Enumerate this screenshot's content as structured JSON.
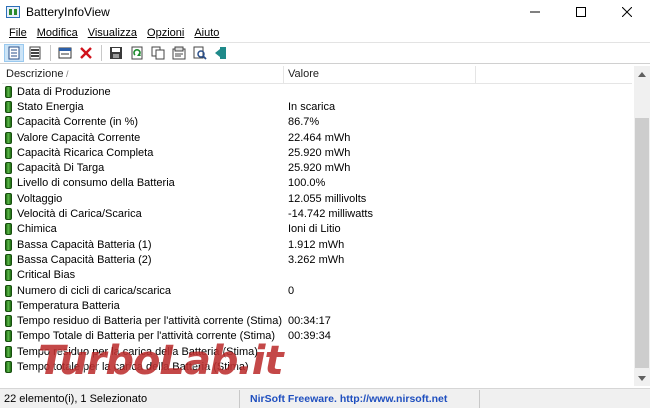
{
  "window": {
    "title": "BatteryInfoView"
  },
  "menu": [
    {
      "label": "File",
      "name": "menu-file"
    },
    {
      "label": "Modifica",
      "name": "menu-modifica"
    },
    {
      "label": "Visualizza",
      "name": "menu-visualizza"
    },
    {
      "label": "Opzioni",
      "name": "menu-opzioni"
    },
    {
      "label": "Aiuto",
      "name": "menu-aiuto"
    }
  ],
  "toolbar_icons": [
    "battery-info-view-icon",
    "battery-log-view-icon",
    "properties-icon",
    "delete-icon",
    "save-icon",
    "refresh-icon",
    "copy-icon",
    "html-report-icon",
    "find-icon",
    "exit-icon"
  ],
  "columns": {
    "name": "Descrizione",
    "value": "Valore"
  },
  "rows": [
    {
      "name": "Data di Produzione",
      "value": ""
    },
    {
      "name": "Stato Energia",
      "value": "In scarica"
    },
    {
      "name": "Capacità Corrente (in %)",
      "value": "86.7%"
    },
    {
      "name": "Valore Capacità Corrente",
      "value": "22.464 mWh"
    },
    {
      "name": "Capacità Ricarica Completa",
      "value": "25.920 mWh"
    },
    {
      "name": "Capacità Di Targa",
      "value": "25.920 mWh"
    },
    {
      "name": "Livello di consumo della Batteria",
      "value": "100.0%"
    },
    {
      "name": "Voltaggio",
      "value": "12.055 millivolts"
    },
    {
      "name": "Velocità di Carica/Scarica",
      "value": "-14.742 milliwatts"
    },
    {
      "name": "Chimica",
      "value": "Ioni di Litio"
    },
    {
      "name": "Bassa Capacità Batteria (1)",
      "value": "1.912 mWh"
    },
    {
      "name": "Bassa Capacità Batteria (2)",
      "value": "3.262 mWh"
    },
    {
      "name": "Critical Bias",
      "value": ""
    },
    {
      "name": "Numero di cicli di carica/scarica",
      "value": "0"
    },
    {
      "name": "Temperatura Batteria",
      "value": ""
    },
    {
      "name": "Tempo residuo di Batteria per l'attività corrente (Stima)",
      "value": "00:34:17"
    },
    {
      "name": "Tempo Totale di Batteria per l'attività corrente (Stima)",
      "value": "00:39:34"
    },
    {
      "name": "Tempo residuo per la carica della Batteria (Stima)",
      "value": ""
    },
    {
      "name": "Tempo totale per la carica della Batteria (Stima)",
      "value": ""
    }
  ],
  "status": {
    "count": "22 elemento(i), 1 Selezionato",
    "credit": "NirSoft Freeware.  http://www.nirsoft.net"
  },
  "watermark": "TurboLab.it"
}
